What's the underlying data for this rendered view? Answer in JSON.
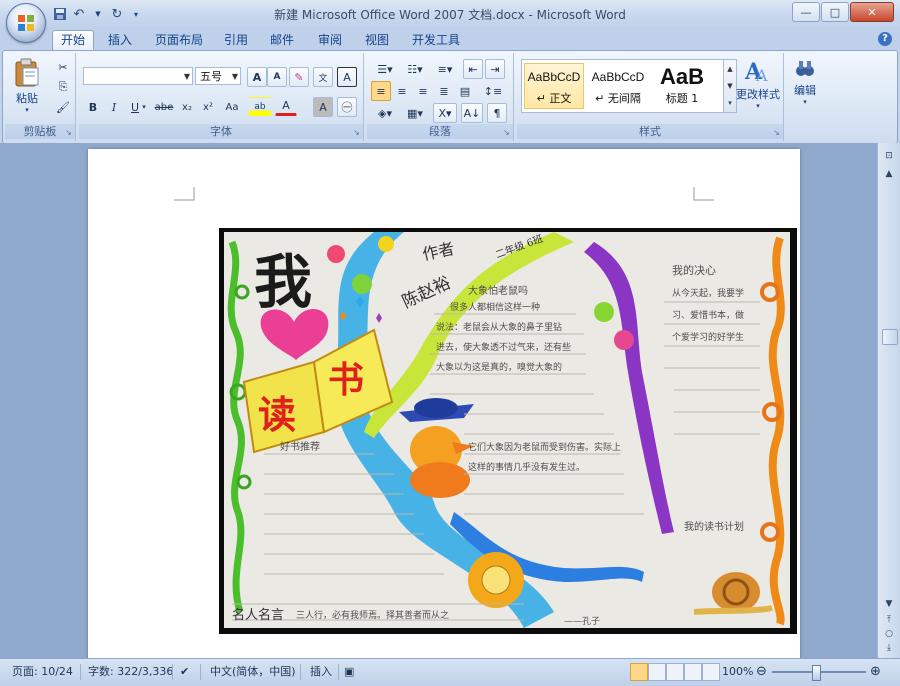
{
  "window": {
    "title": "新建 Microsoft Office Word 2007 文档.docx - Microsoft Word",
    "min": "—",
    "max": "□",
    "close": "✕"
  },
  "tabs": [
    "开始",
    "插入",
    "页面布局",
    "引用",
    "邮件",
    "审阅",
    "视图",
    "开发工具"
  ],
  "active_tab": "开始",
  "clipboard": {
    "paste": "粘贴",
    "group": "剪贴板"
  },
  "font": {
    "name": "",
    "size": "五号",
    "group": "字体",
    "grow": "A",
    "shrink": "A",
    "bold": "B",
    "italic": "I",
    "underline": "U",
    "strike": "abe",
    "sub": "x₂",
    "sup": "x²",
    "case": "Aa",
    "highlight": "ab",
    "color": "A",
    "shade": "A",
    "wen": "文",
    "phon": "wén",
    "border": "A"
  },
  "paragraph": {
    "group": "段落"
  },
  "styles": {
    "group": "样式",
    "items": [
      {
        "sample": "AaBbCcD",
        "name": "↵ 正文"
      },
      {
        "sample": "AaBbCcD",
        "name": "↵ 无间隔"
      },
      {
        "sample": "AaB",
        "name": "标题 1"
      }
    ],
    "change": "更改样式"
  },
  "editing": {
    "label": "编辑"
  },
  "statusbar": {
    "page": "页面: 10/24",
    "words": "字数: 322/3,336",
    "lang": "中文(简体，中国)",
    "mode": "插入",
    "zoom": "100%"
  },
  "poster": {
    "big1": "我",
    "big2": "读",
    "big3": "书",
    "author_label": "作者",
    "author_name": "陈赵裕",
    "class": "二年级 6班",
    "heading1": "大象怕老鼠吗",
    "heading2": "我的决心",
    "heading3": "好书推荐",
    "heading4": "名人名言",
    "p1_line1": "很多人都相信这样一种",
    "p1_line2": "说法：老鼠会从大象的鼻子里钻",
    "p1_line3": "进去，使大象透不过气来，还有些",
    "p1_line4": "大象以为这是真的，嗅觉大象的",
    "p2_line1": "从今天起，我要学",
    "p2_line2": "习、爱惜书本，做",
    "p2_line3": "个爱学习的好学生",
    "quote": "三人行，必有我师焉。择其善者而从之",
    "quote_author": "——孔子",
    "p3_line1": "它们大象因为老鼠而受到伤害。实际上",
    "p3_line2": "这样的事情几乎没有发生过。",
    "signoff": "我的读书计划"
  }
}
